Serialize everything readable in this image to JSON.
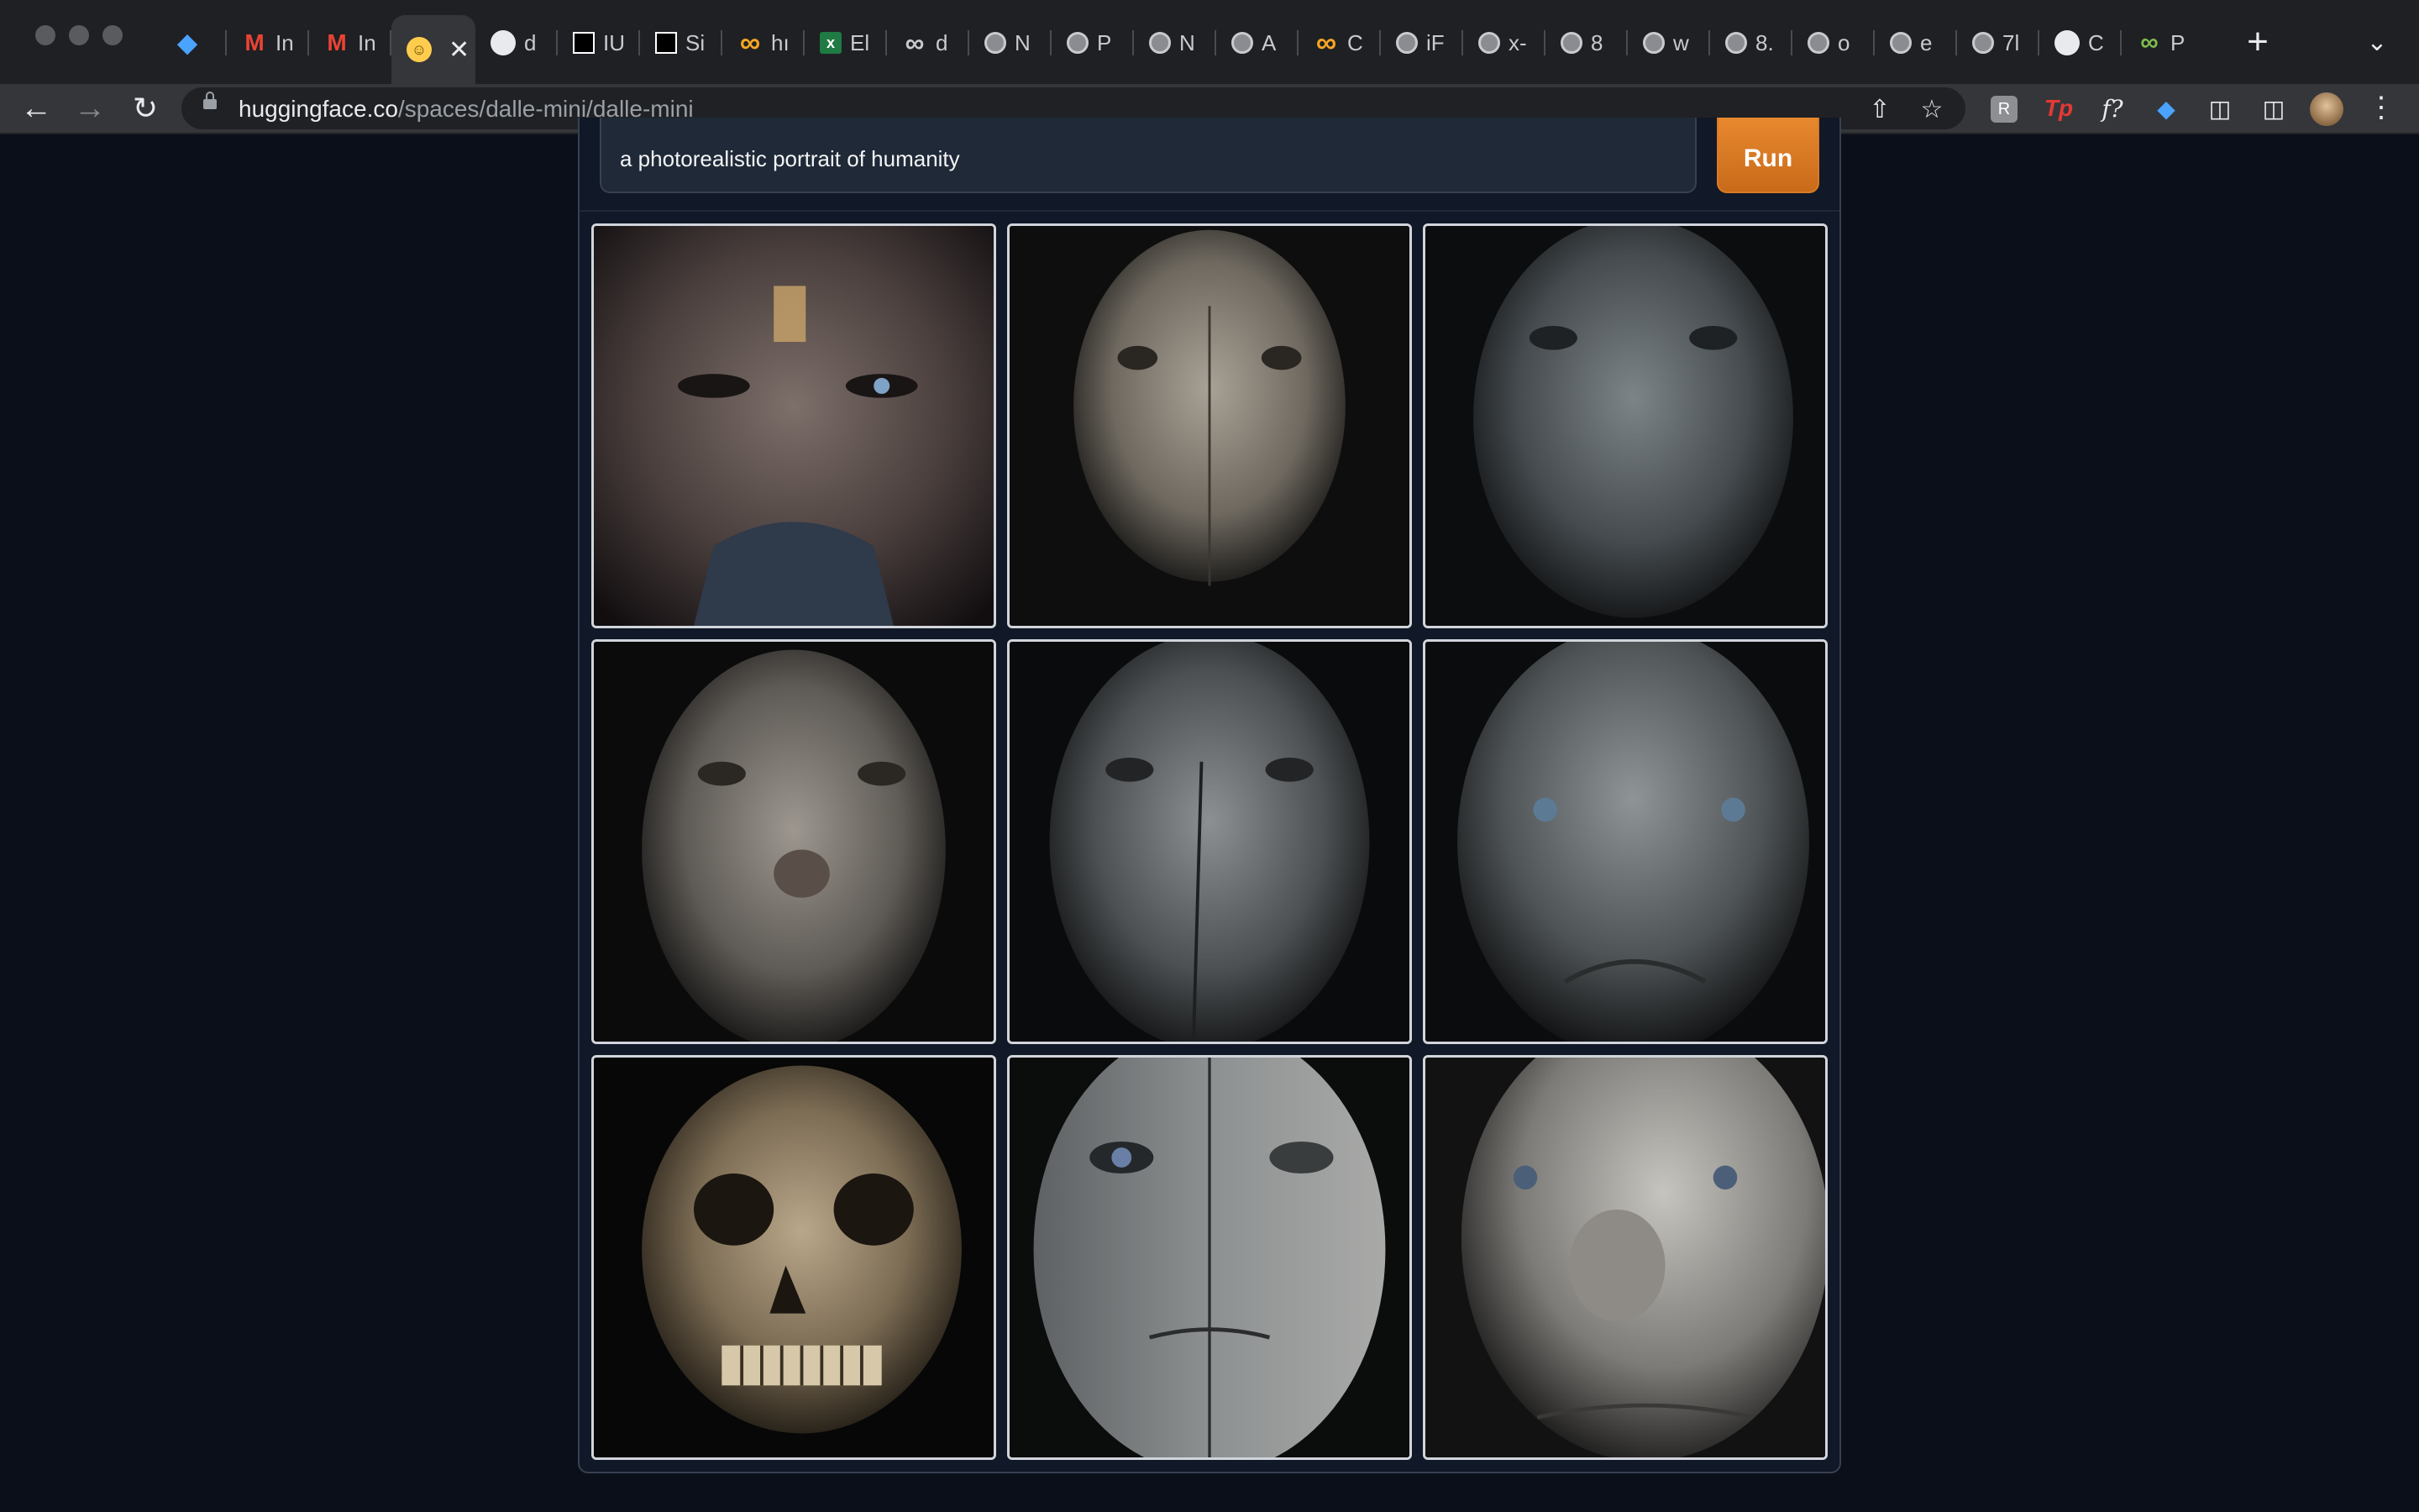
{
  "browser": {
    "tabs": [
      {
        "label": "",
        "icon": "gem-icon"
      },
      {
        "label": "In",
        "icon": "gmail-icon"
      },
      {
        "label": "In",
        "icon": "gmail-icon"
      },
      {
        "label": "",
        "icon": "huggingface-icon",
        "active": true
      },
      {
        "label": "d",
        "icon": "github-icon"
      },
      {
        "label": "IU",
        "icon": "square-app-icon"
      },
      {
        "label": "Si",
        "icon": "square-app-icon"
      },
      {
        "label": "hı",
        "icon": "infinity-icon"
      },
      {
        "label": "El",
        "icon": "excel-icon"
      },
      {
        "label": "d",
        "icon": "glasses-icon"
      },
      {
        "label": "N",
        "icon": "globe-icon"
      },
      {
        "label": "P",
        "icon": "globe-icon"
      },
      {
        "label": "N",
        "icon": "globe-icon"
      },
      {
        "label": "A",
        "icon": "globe-icon"
      },
      {
        "label": "C",
        "icon": "infinity-icon"
      },
      {
        "label": "iF",
        "icon": "globe-icon"
      },
      {
        "label": "x-",
        "icon": "globe-icon"
      },
      {
        "label": "8",
        "icon": "globe-icon"
      },
      {
        "label": "w",
        "icon": "globe-icon"
      },
      {
        "label": "8.",
        "icon": "globe-icon"
      },
      {
        "label": "o",
        "icon": "globe-icon"
      },
      {
        "label": "e",
        "icon": "globe-icon"
      },
      {
        "label": "7l",
        "icon": "globe-icon"
      },
      {
        "label": "C",
        "icon": "github-icon"
      },
      {
        "label": "P",
        "icon": "eye-icon"
      }
    ],
    "url_host": "huggingface.co",
    "url_path": "/spaces/dalle-mini/dalle-mini"
  },
  "app": {
    "prompt_value": "a photorealistic portrait  of humanity",
    "run_label": "Run",
    "accent_color": "#d97a25",
    "image_count": 9
  }
}
